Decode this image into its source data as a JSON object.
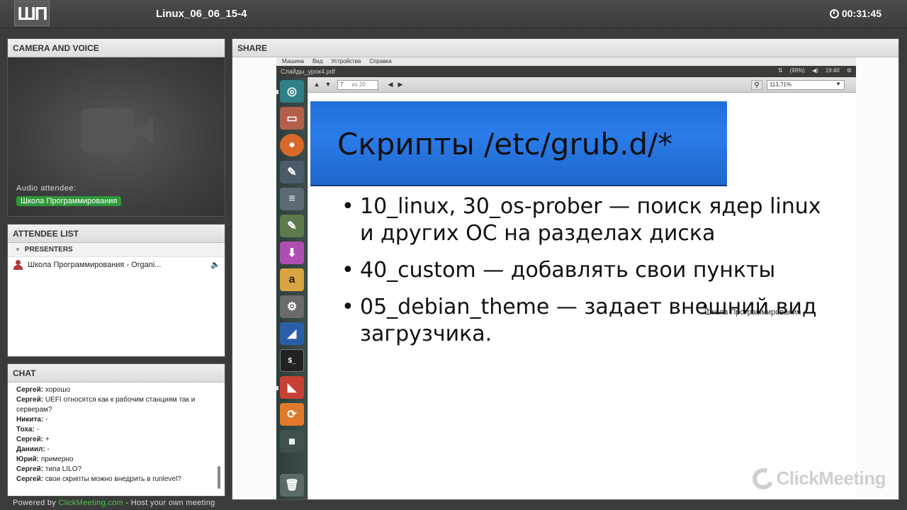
{
  "header": {
    "logo_text": "ШП",
    "title": "Linux_06_06_15-4",
    "timer": "00:31:45"
  },
  "camera": {
    "heading": "CAMERA AND VOICE",
    "audio_label": "Audio attendee:",
    "audio_name": "Школа Программирования"
  },
  "attendees": {
    "heading": "ATTENDEE LIST",
    "presenters_label": "PRESENTERS",
    "presenter": "Школа Программирования - Organi..."
  },
  "chat": {
    "heading": "CHAT",
    "messages": [
      {
        "author": "Сергей:",
        "text": "хорошо"
      },
      {
        "author": "Сергей:",
        "text": "UEFI относятся как к рабочим станциям так и серверам?"
      },
      {
        "author": "Никита:",
        "text": "-"
      },
      {
        "author": "Тоха:",
        "text": "-"
      },
      {
        "author": "Сергей:",
        "text": "+"
      },
      {
        "author": "Даниил:",
        "text": "-"
      },
      {
        "author": "Юрий:",
        "text": "примерно"
      },
      {
        "author": "Сергей:",
        "text": "типа LILO?"
      },
      {
        "author": "Сергей:",
        "text": "свои скрипты можно внедрить в runlevel?"
      }
    ]
  },
  "footer": {
    "prefix": "Powered by",
    "link": "ClickMeeting.com",
    "suffix": "- Host your own meeting"
  },
  "share": {
    "heading": "SHARE",
    "vm_menu": [
      "Машина",
      "Вид",
      "Устройства",
      "Справка"
    ],
    "window_title": "Слайды_урок4.pdf",
    "status": {
      "battery": "(99%)",
      "time": "19:40"
    },
    "page_current": "7",
    "page_total": "из 20",
    "zoom": "113,71%",
    "slide_title": "Скрипты /etc/grub.d/*",
    "bullets": [
      "10_linux, 30_os-prober — поиск ядер linux и других ОС на разделах диска",
      "40_custom — добавлять свои пункты",
      "05_debian_theme — задает внешний вид загрузчика."
    ],
    "cursor_label": "Школа Программирования",
    "watermark": "ClickMeeting"
  },
  "colors": {
    "accent_green": "#2e9a3a",
    "slide_header_blue": "#2b7cea",
    "launcher_bg": "#2c3b3b"
  },
  "icons": [
    "clock-icon",
    "camera-icon",
    "person-icon",
    "speaker-icon",
    "ubuntu-icon",
    "folder-icon",
    "firefox-icon",
    "terminal-icon",
    "trash-icon"
  ]
}
